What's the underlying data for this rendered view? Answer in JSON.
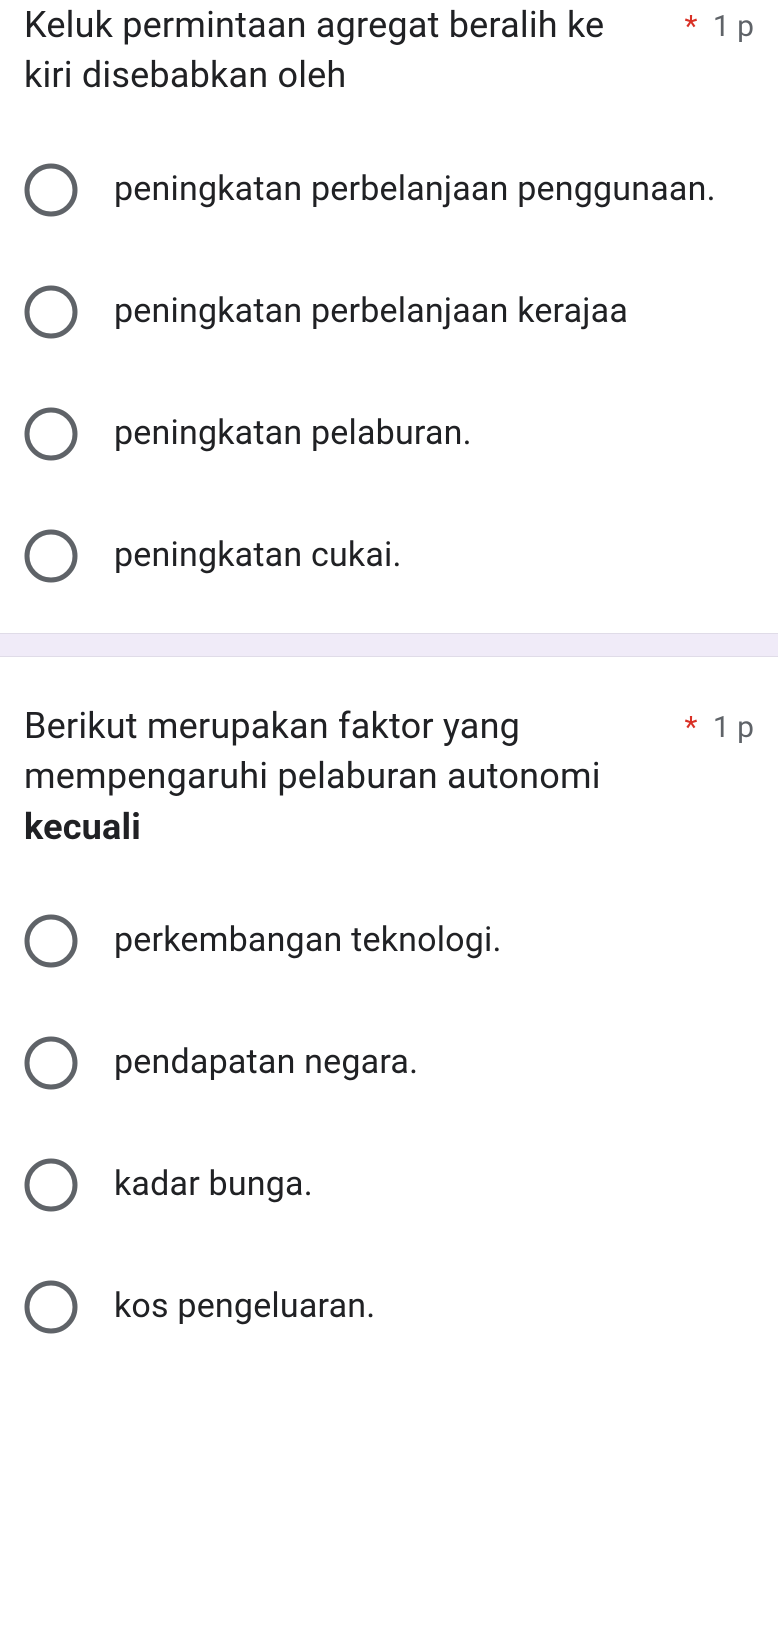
{
  "questions": [
    {
      "text_before": "Keluk permintaan agregat beralih ke kiri disebabkan oleh",
      "text_bold": "",
      "required": "*",
      "points": "1 p",
      "options": [
        "peningkatan perbelanjaan penggunaan.",
        "peningkatan perbelanjaan kerajaa",
        "peningkatan pelaburan.",
        "peningkatan cukai."
      ]
    },
    {
      "text_before": "Berikut merupakan faktor yang mempengaruhi pelaburan autonomi ",
      "text_bold": "kecuali",
      "required": "*",
      "points": "1 p",
      "options": [
        "perkembangan teknologi.",
        "pendapatan negara.",
        "kadar bunga.",
        "kos pengeluaran."
      ]
    }
  ]
}
